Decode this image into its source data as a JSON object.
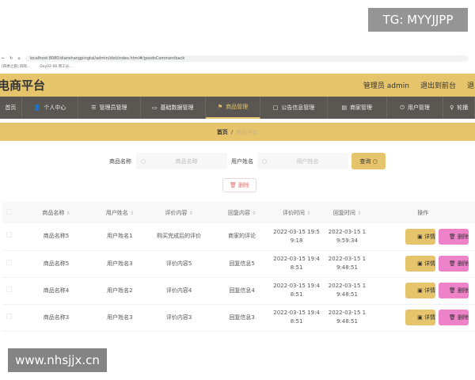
{
  "watermarks": {
    "top": "TG: MYYJJPP",
    "bottom": "www.nhsjjx.cn"
  },
  "browser": {
    "url": "localhost:8080/dianshangpingtai/admin/dist/index.html#/goodsCommentback",
    "bookmarks": [
      "[四季之旅] 四际...",
      "Day02-06.周工分..."
    ]
  },
  "header": {
    "title": "电商平台",
    "user": "管理员 admin",
    "front": "退出到前台",
    "logout": "退出"
  },
  "nav": [
    {
      "label": "首页",
      "icon": ""
    },
    {
      "label": "个人中心",
      "icon": "user-icon"
    },
    {
      "label": "管理员管理",
      "icon": "list-icon"
    },
    {
      "label": "基础数据管理",
      "icon": "briefcase-icon"
    },
    {
      "label": "商品管理",
      "icon": "flag-icon",
      "active": true
    },
    {
      "label": "公告信息管理",
      "icon": "square-icon"
    },
    {
      "label": "商家管理",
      "icon": "document-icon"
    },
    {
      "label": "用户管理",
      "icon": "power-icon"
    },
    {
      "label": "轮播",
      "icon": "bulb-icon"
    }
  ],
  "breadcrumb": {
    "home": "首页",
    "sep": "/",
    "current": "商品评价"
  },
  "search": {
    "goods_label": "商品名称",
    "goods_placeholder": "商品名称",
    "user_label": "用户姓名",
    "user_placeholder": "用户姓名",
    "query": "查询"
  },
  "toolbar": {
    "delete": "删除"
  },
  "table": {
    "headers": [
      "商品名称",
      "用户姓名",
      "评价内容",
      "回复内容",
      "评价时间",
      "回复时间",
      "操作"
    ],
    "rows": [
      [
        "商品名称5",
        "用户姓名1",
        "购买完成后的评价",
        "商家的评论",
        "2022-03-15 19:59:18",
        "2022-03-15 19:59:34"
      ],
      [
        "商品名称5",
        "用户姓名3",
        "评价内容5",
        "回复信息5",
        "2022-03-15 19:48:51",
        "2022-03-15 19:48:51"
      ],
      [
        "商品名称4",
        "用户姓名2",
        "评价内容4",
        "回复信息4",
        "2022-03-15 19:48:51",
        "2022-03-15 19:48:51"
      ],
      [
        "商品名称3",
        "用户姓名3",
        "评价内容3",
        "回复信息3",
        "2022-03-15 19:48:51",
        "2022-03-15 19:48:51"
      ]
    ],
    "detail": "详情",
    "delete": "删除"
  },
  "colors": {
    "accent": "#e6c46c",
    "nav": "#5a5752",
    "delete": "#ee82c8"
  }
}
